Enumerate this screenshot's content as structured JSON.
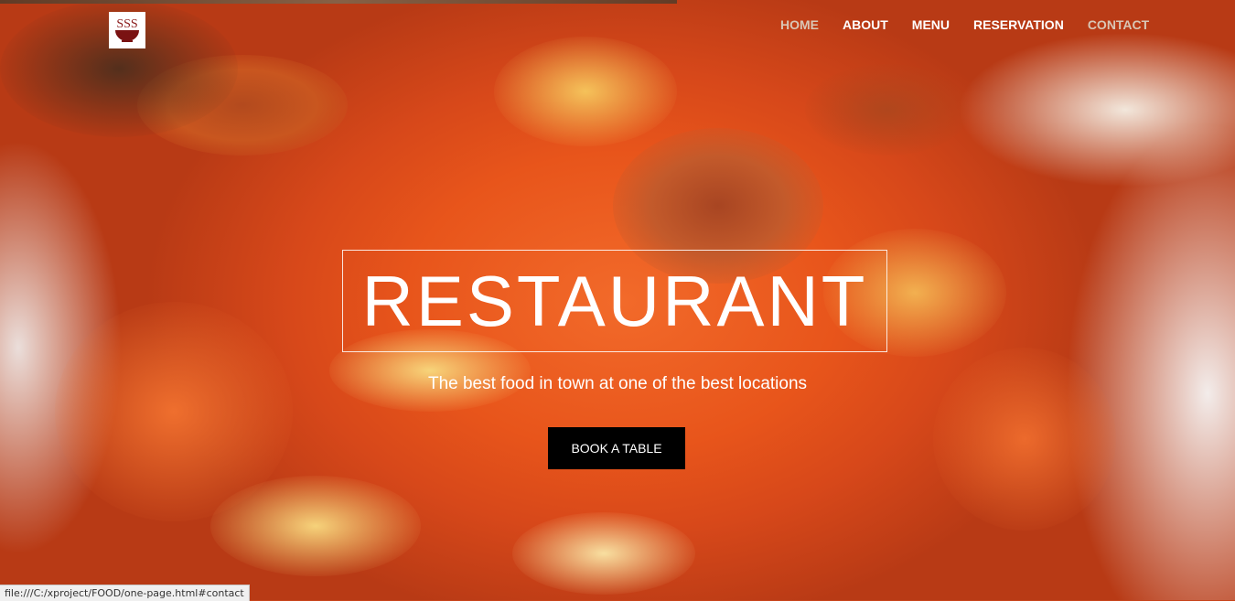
{
  "nav": {
    "items": [
      {
        "label": "HOME",
        "dim": true
      },
      {
        "label": "ABOUT",
        "dim": false
      },
      {
        "label": "MENU",
        "dim": false
      },
      {
        "label": "RESERVATION",
        "dim": false
      },
      {
        "label": "CONTACT",
        "dim": true
      }
    ]
  },
  "logo": {
    "icon": "bowl-logo-icon",
    "text": "SSS"
  },
  "hero": {
    "title": "RESTAURANT",
    "tagline": "The best food in town at one of the best locations",
    "button_label": "BOOK A TABLE",
    "image": "food-photo-shrimp-dish"
  },
  "status_bar": {
    "url": "file:///C:/xproject/FOOD/one-page.html#contact"
  },
  "colors": {
    "accent": "#000000",
    "text": "#ffffff"
  }
}
